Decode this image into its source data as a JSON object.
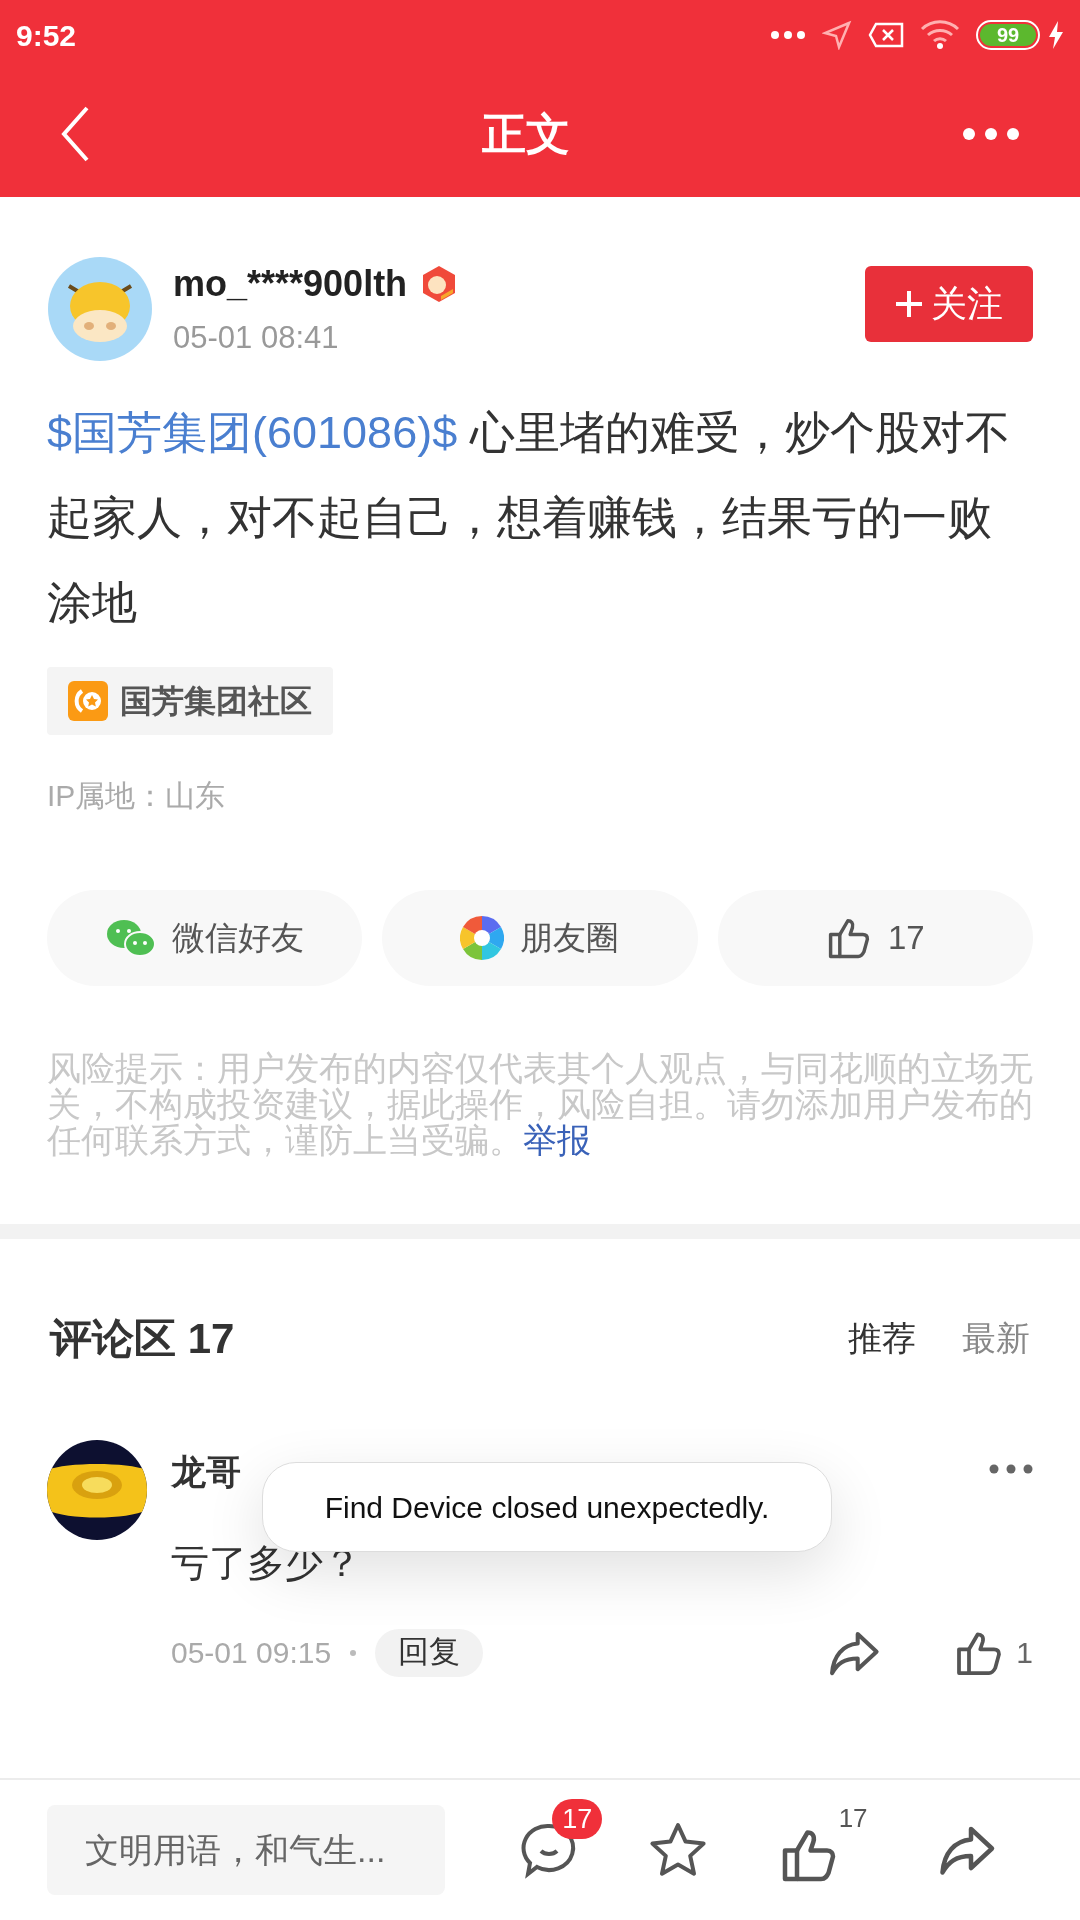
{
  "status_bar": {
    "time": "9:52",
    "battery": "99"
  },
  "header": {
    "title": "正文"
  },
  "post": {
    "author": "mo_****900lth",
    "time": "05-01 08:41",
    "follow": "关注",
    "stock_link": "$国芳集团(601086)$",
    "text": "心里堵的难受，炒个股对不起家人，对不起自己，想着赚钱，结果亏的一败涂地",
    "community": "国芳集团社区",
    "ip": "IP属地：山东"
  },
  "share": [
    {
      "kind": "wechat",
      "label": "微信好友"
    },
    {
      "kind": "moments",
      "label": "朋友圈"
    },
    {
      "kind": "like",
      "label": "17"
    }
  ],
  "risk": {
    "text": "风险提示：用户发布的内容仅代表其个人观点，与同花顺的立场无关，不构成投资建议，据此操作，风险自担。请勿添加用户发布的任何联系方式，谨防上当受骗。",
    "report": "举报"
  },
  "comments": {
    "title": "评论区 17",
    "sorts": [
      {
        "label": "推荐",
        "selected": true
      },
      {
        "label": "最新",
        "selected": false
      }
    ],
    "items": [
      {
        "author": "龙哥",
        "text": "亏了多少？",
        "time": "05-01 09:15",
        "reply": "回复",
        "likes": "1"
      }
    ]
  },
  "toast": "Find Device closed unexpectedly.",
  "bottom_bar": {
    "placeholder": "文明用语，和气生...",
    "comment_badge": "17",
    "like_count": "17"
  }
}
